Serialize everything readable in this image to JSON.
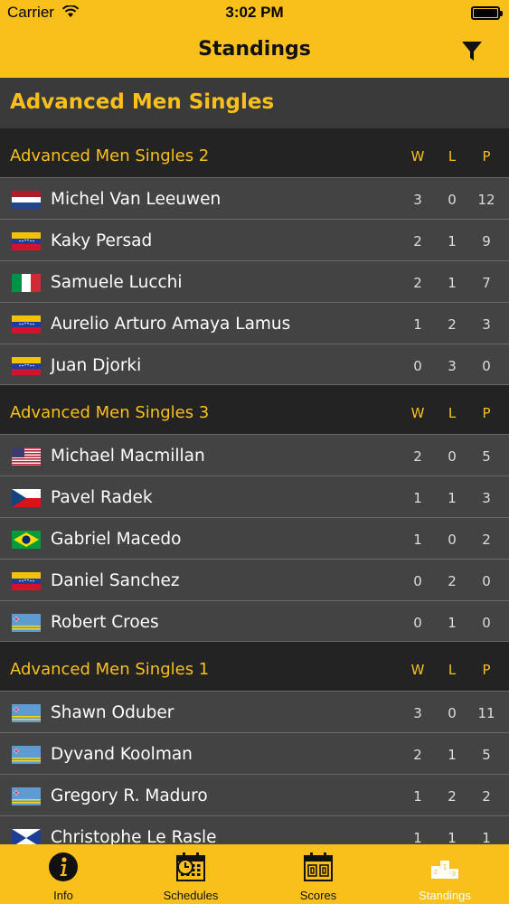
{
  "status_bar": {
    "carrier": "Carrier",
    "time": "3:02 PM",
    "battery_level": 1.0
  },
  "nav": {
    "title": "Standings",
    "filter_icon": "filter-icon"
  },
  "page_heading": "Advanced Men Singles",
  "groups": [
    {
      "name": "Advanced Men Singles 2",
      "cols": {
        "w": "W",
        "l": "L",
        "p": "P"
      },
      "players": [
        {
          "name": "Michel Van Leeuwen",
          "flag": "netherlands",
          "w": "3",
          "l": "0",
          "p": "12"
        },
        {
          "name": "Kaky Persad",
          "flag": "venezuela",
          "w": "2",
          "l": "1",
          "p": "9"
        },
        {
          "name": "Samuele Lucchi",
          "flag": "italy",
          "w": "2",
          "l": "1",
          "p": "7"
        },
        {
          "name": "Aurelio Arturo Amaya Lamus",
          "flag": "venezuela",
          "w": "1",
          "l": "2",
          "p": "3"
        },
        {
          "name": "Juan Djorki",
          "flag": "venezuela",
          "w": "0",
          "l": "3",
          "p": "0"
        }
      ]
    },
    {
      "name": "Advanced Men Singles 3",
      "cols": {
        "w": "W",
        "l": "L",
        "p": "P"
      },
      "players": [
        {
          "name": "Michael Macmillan",
          "flag": "usa",
          "w": "2",
          "l": "0",
          "p": "5"
        },
        {
          "name": "Pavel Radek",
          "flag": "czech",
          "w": "1",
          "l": "1",
          "p": "3"
        },
        {
          "name": "Gabriel Macedo",
          "flag": "brazil",
          "w": "1",
          "l": "0",
          "p": "2"
        },
        {
          "name": "Daniel Sanchez",
          "flag": "venezuela",
          "w": "0",
          "l": "2",
          "p": "0"
        },
        {
          "name": "Robert Croes",
          "flag": "aruba",
          "w": "0",
          "l": "1",
          "p": "0"
        }
      ]
    },
    {
      "name": "Advanced Men Singles 1",
      "cols": {
        "w": "W",
        "l": "L",
        "p": "P"
      },
      "players": [
        {
          "name": "Shawn Oduber",
          "flag": "aruba",
          "w": "3",
          "l": "0",
          "p": "11"
        },
        {
          "name": "Dyvand Koolman",
          "flag": "aruba",
          "w": "2",
          "l": "1",
          "p": "5"
        },
        {
          "name": "Gregory R. Maduro",
          "flag": "aruba",
          "w": "1",
          "l": "2",
          "p": "2"
        },
        {
          "name": "Christophe Le Rasle",
          "flag": "france-partial",
          "w": "1",
          "l": "1",
          "p": "1"
        }
      ]
    }
  ],
  "tabs": [
    {
      "label": "Info",
      "icon": "info-icon",
      "active": false
    },
    {
      "label": "Schedules",
      "icon": "calendar-icon",
      "active": false
    },
    {
      "label": "Scores",
      "icon": "scoreboard-icon",
      "active": false
    },
    {
      "label": "Standings",
      "icon": "podium-icon",
      "active": true
    }
  ],
  "colors": {
    "accent": "#f9c01c",
    "row_bg": "#434343",
    "header_bg": "#232323",
    "heading_bg": "#3a3a3a"
  }
}
